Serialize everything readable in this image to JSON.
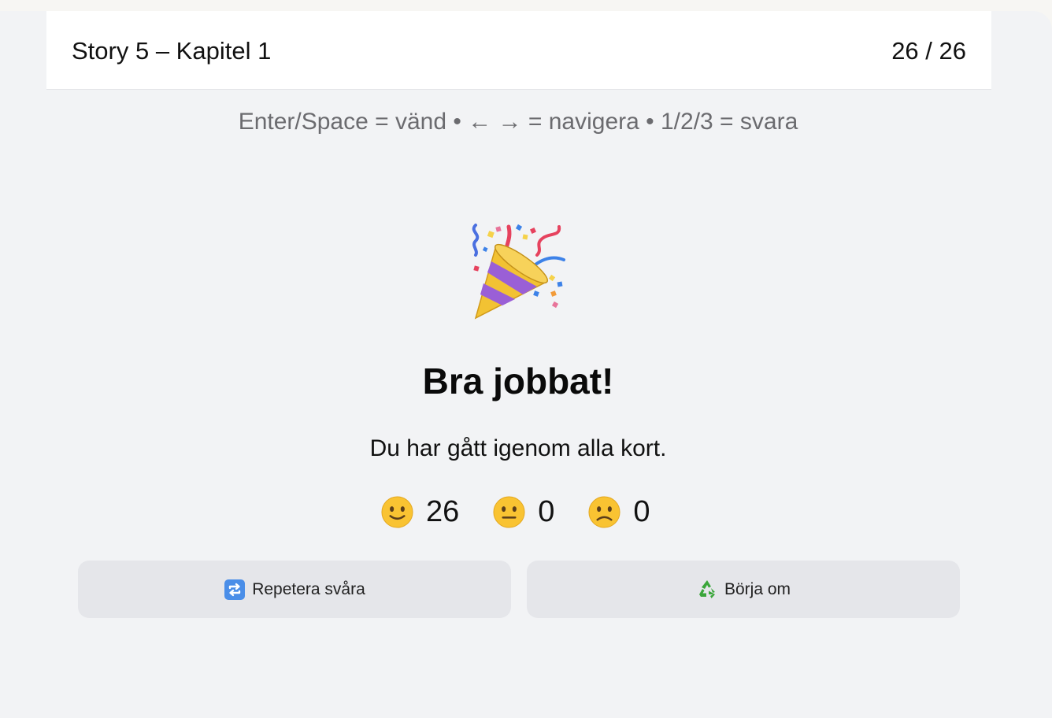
{
  "header": {
    "title": "Story 5 – Kapitel 1",
    "counter": "26 / 26"
  },
  "hint": "Enter/Space = vänd • ← → = navigera • 1/2/3 = svara",
  "completion": {
    "icon": "party-popper-icon",
    "headline": "Bra jobbat!",
    "message": "Du har gått igenom alla kort."
  },
  "stats": [
    {
      "icon": "slightly-smiling-face-icon",
      "value": "26"
    },
    {
      "icon": "neutral-face-icon",
      "value": "0"
    },
    {
      "icon": "slightly-frowning-face-icon",
      "value": "0"
    }
  ],
  "buttons": {
    "repeat_hard": {
      "icon": "repeat-icon",
      "label": "Repetera svåra"
    },
    "restart": {
      "icon": "recycle-icon",
      "label": "Börja om"
    }
  },
  "colors": {
    "background": "#f2f3f5",
    "header_bg": "#ffffff",
    "button_bg": "#e5e6ea",
    "hint_text": "#6b6b6f",
    "emoji_yellow": "#f9c332",
    "repeat_icon_blue": "#4a8ee8",
    "recycle_green": "#3aa63a"
  }
}
